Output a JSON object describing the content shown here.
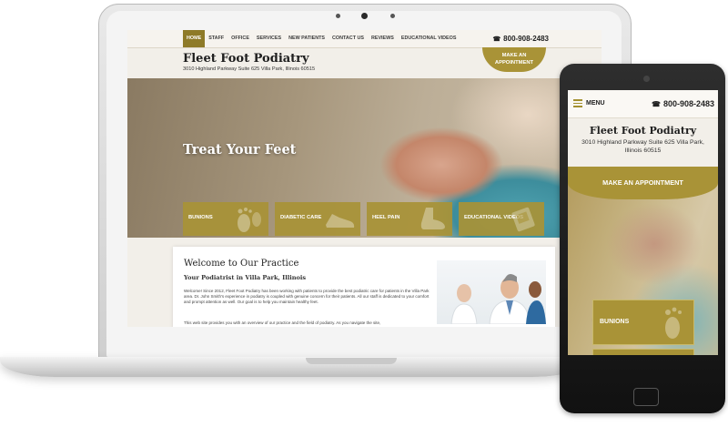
{
  "nav": {
    "items": [
      {
        "label": "HOME",
        "active": true
      },
      {
        "label": "STAFF"
      },
      {
        "label": "OFFICE"
      },
      {
        "label": "SERVICES"
      },
      {
        "label": "NEW PATIENTS"
      },
      {
        "label": "CONTACT US"
      },
      {
        "label": "REVIEWS"
      },
      {
        "label": "EDUCATIONAL VIDEOS"
      }
    ],
    "phone": "800-908-2483",
    "phone_icon": "phone-icon"
  },
  "brand": {
    "name": "Fleet Foot Podiatry",
    "address": "3010 Highland Parkway Suite 625 Villa Park, Illinois 60515"
  },
  "appointment_label": "MAKE AN APPOINTMENT",
  "hero": {
    "title": "Treat Your Feet"
  },
  "tiles": [
    {
      "label": "BUNIONS",
      "icon": "footprint-icon"
    },
    {
      "label": "DIABETIC CARE",
      "icon": "shoe-icon"
    },
    {
      "label": "HEEL PAIN",
      "icon": "foot-icon"
    },
    {
      "label": "EDUCATIONAL VIDEOS",
      "icon": "video-icon"
    }
  ],
  "welcome": {
    "heading": "Welcome to Our Practice",
    "subheading": "Your Podiatrist in Villa Park, Illinois",
    "body": "Welcome! Since 2012, Fleet Foot Podiatry has been working with patients to provide the best podiatric care for patients in the Villa Park area. Dr. John Smith's experience in podiatry is coupled with genuine concern for their patients. All our staff is dedicated to your comfort and prompt attention as well. Our goal is to help you maintain healthy feet.",
    "body2": "This web site provides you with an overview of our practice and the field of podiatry. As you navigate the site,"
  },
  "mobile": {
    "menu_label": "MENU",
    "first_tile": "BUNIONS"
  },
  "colors": {
    "accent_gold": "#a99337",
    "nav_active": "#8e7a28"
  }
}
